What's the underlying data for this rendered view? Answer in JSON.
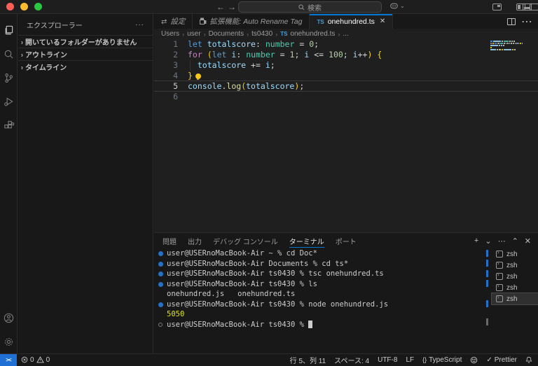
{
  "title_bar": {
    "search_placeholder": "検索",
    "back_arrow": "←",
    "forward_arrow": "→"
  },
  "editor_tabs": [
    {
      "icon": "settings",
      "label": "設定",
      "italic": true,
      "active": false,
      "close": false
    },
    {
      "icon": "extensions",
      "label": "拡張機能: Auto Rename Tag",
      "italic": true,
      "active": false,
      "close": false
    },
    {
      "icon": "ts",
      "label": "onehundred.ts",
      "italic": false,
      "active": true,
      "close": true
    }
  ],
  "breadcrumb": {
    "segments": [
      "Users",
      "user",
      "Documents",
      "ts0430"
    ],
    "file_icon": "TS",
    "file": "onehundred.ts",
    "tail": "..."
  },
  "sidebar": {
    "title": "エクスプローラー",
    "more": "···",
    "sections": [
      {
        "label": "開いているフォルダーがありません"
      },
      {
        "label": "アウトライン"
      },
      {
        "label": "タイムライン"
      }
    ]
  },
  "code_lines": [
    {
      "num": "1",
      "active": false,
      "indent_guide": false,
      "tokens": [
        [
          "kw",
          "let"
        ],
        [
          "pl",
          " "
        ],
        [
          "vr",
          "totalscore"
        ],
        [
          "pn",
          ":"
        ],
        [
          "pl",
          " "
        ],
        [
          "ty",
          "number"
        ],
        [
          "pl",
          " "
        ],
        [
          "pn",
          "="
        ],
        [
          "pl",
          " "
        ],
        [
          "nm",
          "0"
        ],
        [
          "pn",
          ";"
        ]
      ]
    },
    {
      "num": "2",
      "active": false,
      "indent_guide": false,
      "tokens": [
        [
          "ct",
          "for"
        ],
        [
          "pl",
          " "
        ],
        [
          "br",
          "("
        ],
        [
          "kw",
          "let"
        ],
        [
          "pl",
          " "
        ],
        [
          "vr",
          "i"
        ],
        [
          "pn",
          ":"
        ],
        [
          "pl",
          " "
        ],
        [
          "ty",
          "number"
        ],
        [
          "pl",
          " "
        ],
        [
          "pn",
          "="
        ],
        [
          "pl",
          " "
        ],
        [
          "nm",
          "1"
        ],
        [
          "pn",
          "; "
        ],
        [
          "vr",
          "i"
        ],
        [
          "pl",
          " "
        ],
        [
          "pn",
          "<="
        ],
        [
          "pl",
          " "
        ],
        [
          "nm",
          "100"
        ],
        [
          "pn",
          "; "
        ],
        [
          "vr",
          "i"
        ],
        [
          "pn",
          "++"
        ],
        [
          "br",
          ")"
        ],
        [
          "pl",
          " "
        ],
        [
          "br",
          "{"
        ]
      ]
    },
    {
      "num": "3",
      "active": false,
      "indent_guide": true,
      "tokens": [
        [
          "pl",
          "  "
        ],
        [
          "vr",
          "totalscore"
        ],
        [
          "pl",
          " "
        ],
        [
          "pn",
          "+="
        ],
        [
          "pl",
          " "
        ],
        [
          "vr",
          "i"
        ],
        [
          "pn",
          ";"
        ]
      ]
    },
    {
      "num": "4",
      "active": false,
      "indent_guide": false,
      "bulb": true,
      "tokens": [
        [
          "br",
          "}"
        ]
      ]
    },
    {
      "num": "5",
      "active": true,
      "indent_guide": false,
      "tokens": [
        [
          "vr",
          "console"
        ],
        [
          "pn",
          "."
        ],
        [
          "fn",
          "log"
        ],
        [
          "br",
          "("
        ],
        [
          "vr",
          "totalscore"
        ],
        [
          "br",
          ")"
        ],
        [
          "pn",
          ";"
        ]
      ]
    },
    {
      "num": "6",
      "active": false,
      "indent_guide": false,
      "tokens": []
    }
  ],
  "panel": {
    "tabs": [
      "問題",
      "出力",
      "デバッグ コンソール",
      "ターミナル",
      "ポート"
    ],
    "active_index": 3,
    "actions": [
      "+",
      "⌄",
      "⋯",
      "⌃",
      "✕"
    ]
  },
  "terminal": {
    "lines": [
      {
        "deco": "filled",
        "text": "user@USERnoMacBook-Air ~ % cd Doc*"
      },
      {
        "deco": "filled",
        "text": "user@USERnoMacBook-Air Documents % cd ts*"
      },
      {
        "deco": "filled",
        "text": "user@USERnoMacBook-Air ts0430 % tsc onehundred.ts"
      },
      {
        "deco": "filled",
        "text": "user@USERnoMacBook-Air ts0430 % ls"
      },
      {
        "deco": "none",
        "text": "onehundred.js   onehundred.ts"
      },
      {
        "deco": "filled",
        "text": "user@USERnoMacBook-Air ts0430 % node onehundred.js"
      },
      {
        "deco": "none",
        "text": "5050",
        "yellow": true
      },
      {
        "deco": "hollow",
        "text": "user@USERnoMacBook-Air ts0430 % ",
        "cursor": true
      }
    ],
    "shell_list": [
      "zsh",
      "zsh",
      "zsh",
      "zsh",
      "zsh"
    ],
    "selected_shell_index": 4
  },
  "status_bar": {
    "remote_glyph": "><",
    "errors": "0",
    "warnings": "0",
    "line_col": "行 5、列 11",
    "indent": "スペース: 4",
    "encoding": "UTF-8",
    "eol": "LF",
    "language_icon": "{}",
    "language": "TypeScript",
    "prettier_check": "✓",
    "prettier": "Prettier"
  },
  "colors": {
    "accent": "#0078d4",
    "terminal_yellow": "#e5e510",
    "ts_icon_blue": "#4d9fd6",
    "bracket_gold": "#ffd700",
    "editor_bg": "#1f1f1f",
    "chrome_bg": "#181818"
  }
}
